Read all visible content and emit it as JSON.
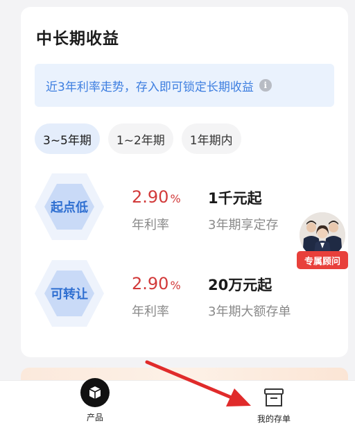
{
  "section": {
    "title": "中长期收益",
    "notice": "近3年利率走势，存入即可锁定长期收益",
    "info_icon": "info-icon"
  },
  "tabs": [
    {
      "label": "3~5年期",
      "active": true
    },
    {
      "label": "1~2年期",
      "active": false
    },
    {
      "label": "1年期内",
      "active": false
    }
  ],
  "products": [
    {
      "badge": "起点低",
      "rate": "2.90",
      "rate_unit": "%",
      "rate_label": "年利率",
      "amount": "1千元起",
      "description": "3年期享定存"
    },
    {
      "badge": "可转让",
      "rate": "2.90",
      "rate_unit": "%",
      "rate_label": "年利率",
      "amount": "20万元起",
      "description": "3年期大额存单"
    }
  ],
  "advisor": {
    "label": "专属顾问"
  },
  "bottom_nav": [
    {
      "label": "产品",
      "icon": "cube-icon"
    },
    {
      "label": "我的存单",
      "icon": "box-icon"
    }
  ],
  "colors": {
    "accent_blue": "#3d7ee0",
    "rate_red": "#d23a3a",
    "advisor_red": "#e8403b",
    "arrow_red": "#e02b2b"
  }
}
